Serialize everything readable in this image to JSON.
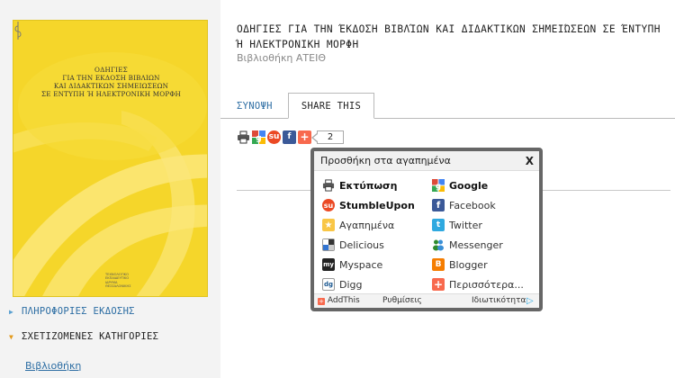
{
  "book": {
    "cover_lines": [
      "ΟΔΗΓΙΕΣ",
      "ΓΙΑ ΤΗΝ ΕΚΔΟΣΗ ΒΙΒΛΙΩΝ",
      "ΚΑΙ ΔΙΔΑΚΤΙΚΩΝ ΣΗΜΕΙΩΣΕΩΝ",
      "ΣΕ ΕΝΤΥΠΗ Ή ΗΛΕΚΤΡΟΝΙΚΗ ΜΟΡΦΗ"
    ],
    "cover_logo_lines": [
      "ΤΕΧΝΟΛΟΓΙΚΟ",
      "ΕΚΠΑΙΔΕΥΤΙΚΟ",
      "ΙΔΡΥΜΑ",
      "ΘΕΣΣΑΛΟΝΙΚΗΣ"
    ]
  },
  "left_links": {
    "publication_info": "ΠΛΗΡΟΦΟΡΙΕΣ ΕΚΔΟΣΗΣ",
    "related_categories": "ΣΧΕΤΙΖΟΜΕΝΕΣ ΚΑΤΗΓΟΡΙΕΣ",
    "library": "Βιβλιοθήκη"
  },
  "document": {
    "title": "ΟΔΗΓΙΕΣ ΓΙΑ ΤΗΝ ΈΚΔΟΣΗ ΒΙΒΛΊΩΝ ΚΑΙ ΔΙΔΑΚΤΙΚΩΝ ΣΗΜΕΙΏΣΕΩΝ ΣΕ ΈΝΤΥΠΗ Ή ΗΛΕΚΤΡΟΝΙΚΗ ΜΟΡΦΗ",
    "subtitle": "Βιβλιοθήκη ΑΤΕΙΘ"
  },
  "tabs": {
    "summary": "ΣΥΝΟΨΗ",
    "share": "SHARE THIS"
  },
  "share_bar": {
    "count": "2",
    "icons": [
      "print-icon",
      "google-icon",
      "stumbleupon-icon",
      "facebook-icon",
      "addthis-plus-icon"
    ]
  },
  "popup": {
    "title": "Προσθήκη στα αγαπημένα",
    "close": "X",
    "left_items": [
      "Εκτύπωση",
      "StumbleUpon",
      "Αγαπημένα",
      "Delicious",
      "Myspace",
      "Digg"
    ],
    "right_items": [
      "Google",
      "Facebook",
      "Twitter",
      "Messenger",
      "Blogger",
      "Περισσότερα..."
    ],
    "footer": {
      "brand": "AddThis",
      "settings": "Ρυθμίσεις",
      "privacy": "Ιδιωτικότητα"
    }
  },
  "colors": {
    "cover_yellow": "#f5d62a",
    "link_blue": "#2c6da3",
    "facebook": "#3b5998",
    "stumbleupon": "#eb4924",
    "addthis": "#f8694d",
    "twitter": "#2fa9e0",
    "blogger": "#f57d00"
  }
}
